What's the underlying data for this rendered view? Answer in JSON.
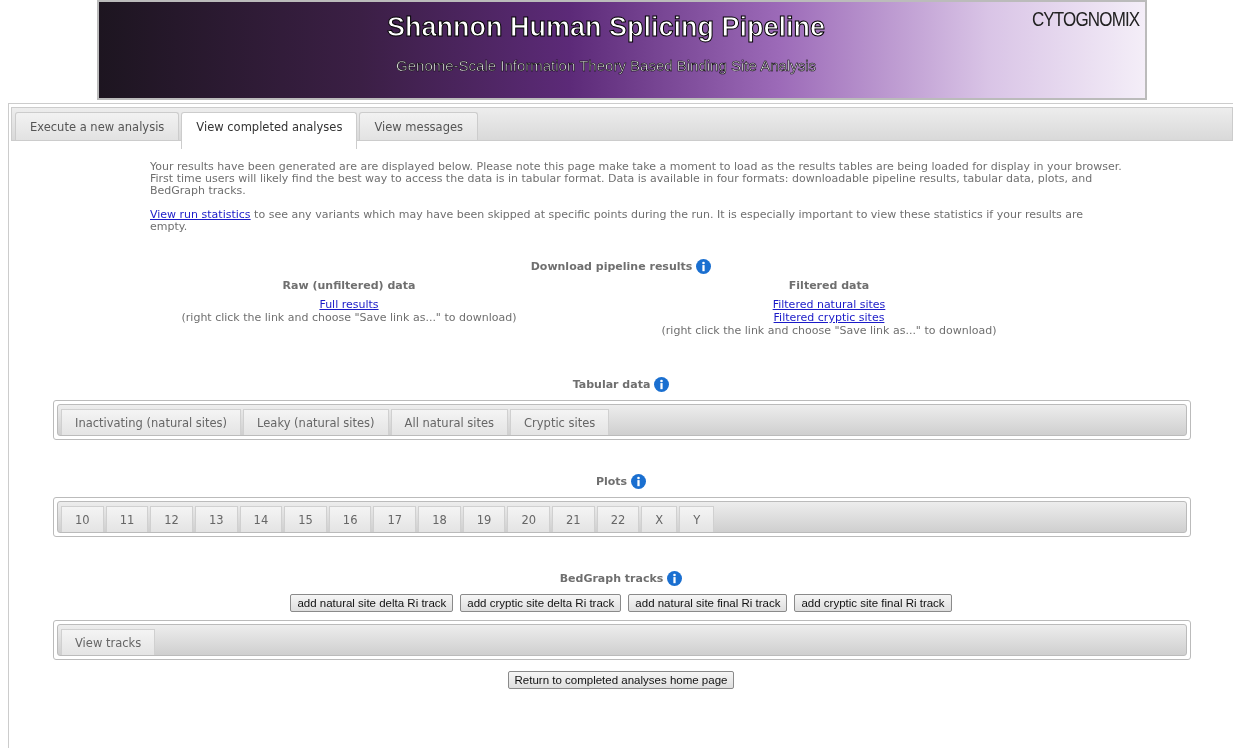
{
  "banner": {
    "title": "Shannon Human Splicing Pipeline",
    "subtitle": "Genome-Scale Information Theory Based Binding Site Analysis",
    "logo": "CYTOGNOMIX"
  },
  "tabs": [
    {
      "label": "Execute a new analysis",
      "selected": false
    },
    {
      "label": "View completed analyses",
      "selected": true
    },
    {
      "label": "View messages",
      "selected": false
    }
  ],
  "intro": "Your results have been generated are are displayed below. Please note this page make take a moment to load as the results tables are being loaded for display in your browser. First time users will likely find the best way to access the data is in tabular format. Data is available in four formats: downloadable pipeline results, tabular data, plots, and BedGraph tracks.",
  "stats": {
    "link": "View run statistics",
    "text": "to see any variants which may have been skipped at specific points during the run. It is especially important to view these statistics if your results are empty."
  },
  "download": {
    "heading": "Download pipeline results",
    "raw": {
      "heading": "Raw (unfiltered) data",
      "links": [
        "Full results"
      ],
      "note": "(right click the link and choose \"Save link as...\" to download)"
    },
    "filtered": {
      "heading": "Filtered data",
      "links": [
        "Filtered natural sites",
        "Filtered cryptic sites"
      ],
      "note": "(right click the link and choose \"Save link as...\" to download)"
    }
  },
  "tabular": {
    "heading": "Tabular data",
    "tabs": [
      {
        "label": "Inactivating (natural sites)",
        "selected": false
      },
      {
        "label": "Leaky (natural sites)",
        "selected": false
      },
      {
        "label": "All natural sites",
        "selected": false
      },
      {
        "label": "Cryptic sites",
        "selected": false
      }
    ]
  },
  "plots": {
    "heading": "Plots",
    "tabs": [
      {
        "label": "10",
        "selected": false
      },
      {
        "label": "11",
        "selected": false
      },
      {
        "label": "12",
        "selected": false
      },
      {
        "label": "13",
        "selected": false
      },
      {
        "label": "14",
        "selected": false
      },
      {
        "label": "15",
        "selected": false
      },
      {
        "label": "16",
        "selected": false
      },
      {
        "label": "17",
        "selected": false
      },
      {
        "label": "18",
        "selected": false
      },
      {
        "label": "19",
        "selected": false
      },
      {
        "label": "20",
        "selected": false
      },
      {
        "label": "21",
        "selected": false
      },
      {
        "label": "22",
        "selected": false
      },
      {
        "label": "X",
        "selected": false
      },
      {
        "label": "Y",
        "selected": false
      }
    ]
  },
  "bedgraph": {
    "heading": "BedGraph tracks",
    "buttons": [
      "add natural site delta Ri track",
      "add cryptic site delta Ri track",
      "add natural site final Ri track",
      "add cryptic site final Ri track"
    ],
    "tabs": [
      {
        "label": "View tracks",
        "selected": false
      }
    ]
  },
  "return_button": "Return to completed analyses home page"
}
